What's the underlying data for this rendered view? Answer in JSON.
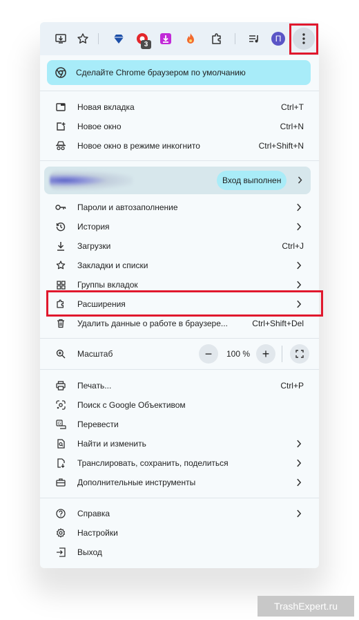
{
  "promo": {
    "text": "Сделайте Chrome браузером по умолчанию"
  },
  "avatar_letter": "П",
  "extension_badge": "3",
  "section1": [
    {
      "label": "Новая вкладка",
      "shortcut": "Ctrl+T",
      "icon": "new-tab-icon"
    },
    {
      "label": "Новое окно",
      "shortcut": "Ctrl+N",
      "icon": "new-window-icon"
    },
    {
      "label": "Новое окно в режиме инкогнито",
      "shortcut": "Ctrl+Shift+N",
      "icon": "incognito-icon"
    }
  ],
  "profile": {
    "status": "Вход выполнен"
  },
  "section2": [
    {
      "label": "Пароли и автозаполнение",
      "icon": "key-icon"
    },
    {
      "label": "История",
      "icon": "history-icon"
    },
    {
      "label": "Загрузки",
      "shortcut": "Ctrl+J",
      "icon": "download-icon"
    },
    {
      "label": "Закладки и списки",
      "icon": "star-icon"
    },
    {
      "label": "Группы вкладок",
      "icon": "tab-groups-icon"
    },
    {
      "label": "Расширения",
      "icon": "puzzle-icon"
    },
    {
      "label": "Удалить данные о работе в браузере...",
      "shortcut": "Ctrl+Shift+Del",
      "icon": "trash-icon"
    }
  ],
  "zoom": {
    "label": "Масштаб",
    "value": "100 %",
    "minus": "−",
    "plus": "+"
  },
  "section3": [
    {
      "label": "Печать...",
      "shortcut": "Ctrl+P",
      "icon": "print-icon"
    },
    {
      "label": "Поиск с Google Объективом",
      "icon": "lens-icon"
    },
    {
      "label": "Перевести",
      "icon": "translate-icon"
    },
    {
      "label": "Найти и изменить",
      "icon": "find-icon"
    },
    {
      "label": "Транслировать, сохранить, поделиться",
      "icon": "cast-save-share-icon"
    },
    {
      "label": "Дополнительные инструменты",
      "icon": "toolbox-icon"
    }
  ],
  "section4": [
    {
      "label": "Справка",
      "icon": "help-icon"
    },
    {
      "label": "Настройки",
      "icon": "settings-icon"
    },
    {
      "label": "Выход",
      "icon": "exit-icon"
    }
  ],
  "watermark": "TrashExpert.ru",
  "colors": {
    "highlight": "#e0182d",
    "promo_bg": "#a8ecf9",
    "menu_bg": "#f6fafc"
  }
}
